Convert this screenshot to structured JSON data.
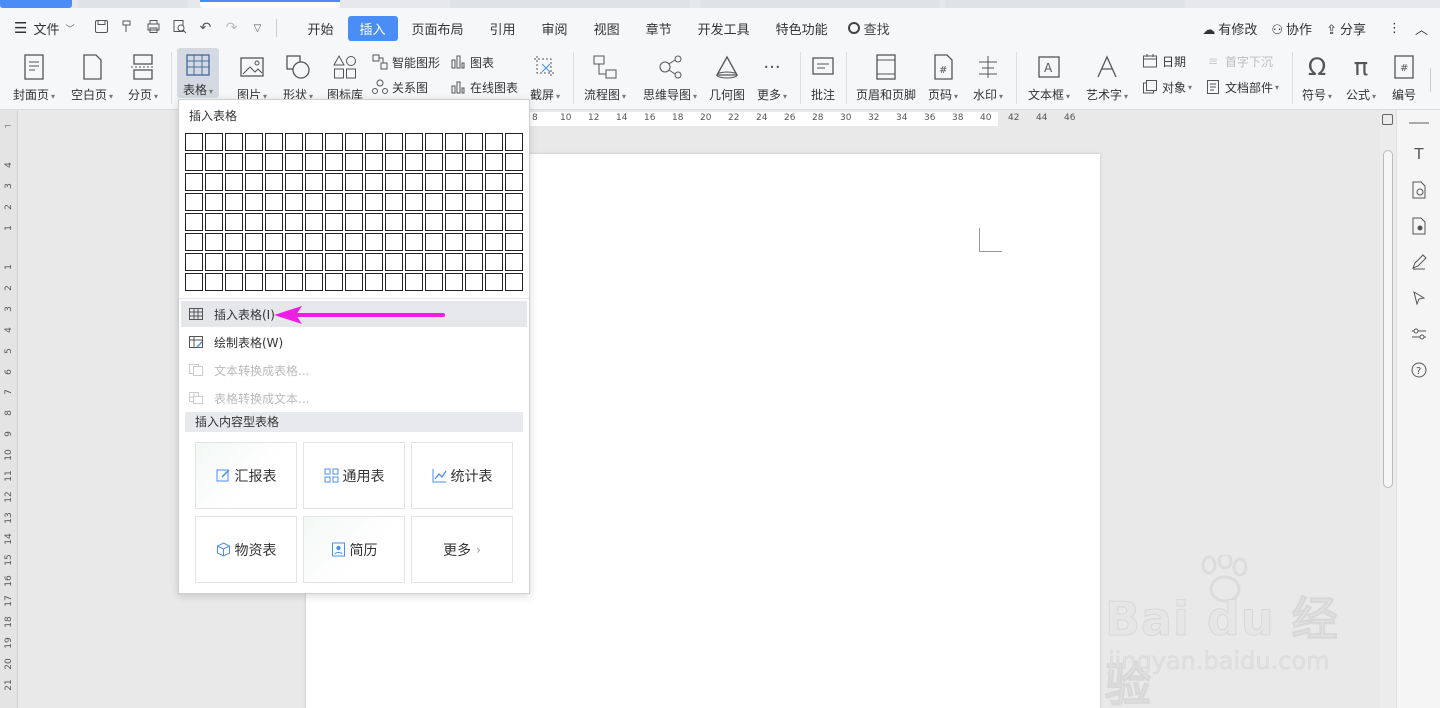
{
  "menubar": {
    "file_label": "文件",
    "tabs": [
      "开始",
      "插入",
      "页面布局",
      "引用",
      "审阅",
      "视图",
      "章节",
      "开发工具",
      "特色功能"
    ],
    "search_label": "查找",
    "right": {
      "modified": "有修改",
      "collab": "协作",
      "share": "分享"
    }
  },
  "ribbon": {
    "cover": "封面页",
    "blank": "空白页",
    "pagebreak": "分页",
    "table": "表格",
    "picture": "图片",
    "shape": "形状",
    "iconlib": "图标库",
    "smartart": "智能图形",
    "chart": "图表",
    "relation": "关系图",
    "online_chart": "在线图表",
    "screenshot": "截屏",
    "flowchart": "流程图",
    "mindmap": "思维导图",
    "geometry": "几何图",
    "more": "更多",
    "comment": "批注",
    "header_footer": "页眉和页脚",
    "page_number": "页码",
    "watermark": "水印",
    "textbox": "文本框",
    "wordart": "艺术字",
    "date": "日期",
    "object": "对象",
    "drop_cap": "首字下沉",
    "doc_parts": "文档部件",
    "symbol": "符号",
    "formula": "公式",
    "numbering": "编号"
  },
  "ruler": {
    "top": [
      "8",
      "10",
      "12",
      "14",
      "16",
      "18",
      "20",
      "22",
      "24",
      "26",
      "28",
      "30",
      "32",
      "34",
      "36",
      "38",
      "40",
      "42",
      "44",
      "46"
    ],
    "left": [
      "4",
      "3",
      "2",
      "1",
      "1",
      "2",
      "3",
      "4",
      "5",
      "6",
      "7",
      "8",
      "9",
      "10",
      "11",
      "12",
      "13",
      "14",
      "15",
      "16",
      "17",
      "18",
      "19",
      "20",
      "21"
    ]
  },
  "dropdown": {
    "header": "插入表格",
    "insert_table": "插入表格(I)",
    "draw_table": "绘制表格(W)",
    "text_to_table": "文本转换成表格...",
    "table_to_text": "表格转换成文本...",
    "content_section": "插入内容型表格",
    "cards": [
      "汇报表",
      "通用表",
      "统计表",
      "物资表",
      "简历",
      "更多"
    ]
  },
  "watermark": {
    "logo": "Bai du 经验",
    "url": "jingyan.baidu.com"
  },
  "colors": {
    "accent": "#4a8df6",
    "arrow": "#ee1fe4"
  }
}
